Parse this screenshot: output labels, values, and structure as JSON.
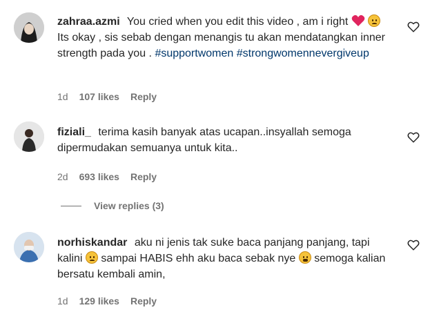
{
  "comments": [
    {
      "username": "zahraa.azmi",
      "text_a": "You cried when you edit this video , am i right",
      "text_b": "Its okay , sis sebab dengan menangis tu akan mendatangkan inner strength pada you .",
      "tag1": "#supportwomen",
      "tag2": "#strongwomennevergiveup",
      "time": "1d",
      "likes": "107 likes",
      "reply": "Reply"
    },
    {
      "username": "fiziali_",
      "text": "terima kasih banyak atas ucapan..insyallah semoga dipermudakan semuanya untuk kita..",
      "time": "2d",
      "likes": "693 likes",
      "reply": "Reply",
      "view_replies": "View replies (3)"
    },
    {
      "username": "norhiskandar",
      "text_a": "aku ni jenis tak suke baca panjang panjang, tapi kalini",
      "text_b": "sampai HABIS ehh aku baca sebak nye",
      "text_c": "semoga kalian bersatu kembali amin,",
      "time": "1d",
      "likes": "129 likes",
      "reply": "Reply"
    }
  ],
  "colors": {
    "text": "#262626",
    "meta": "#737373",
    "hashtag": "#00376b",
    "heart_red": "#e0245e"
  },
  "icons": [
    "heart-outline-icon",
    "red-heart-emoji",
    "sad-face-emoji",
    "weary-face-emoji"
  ]
}
